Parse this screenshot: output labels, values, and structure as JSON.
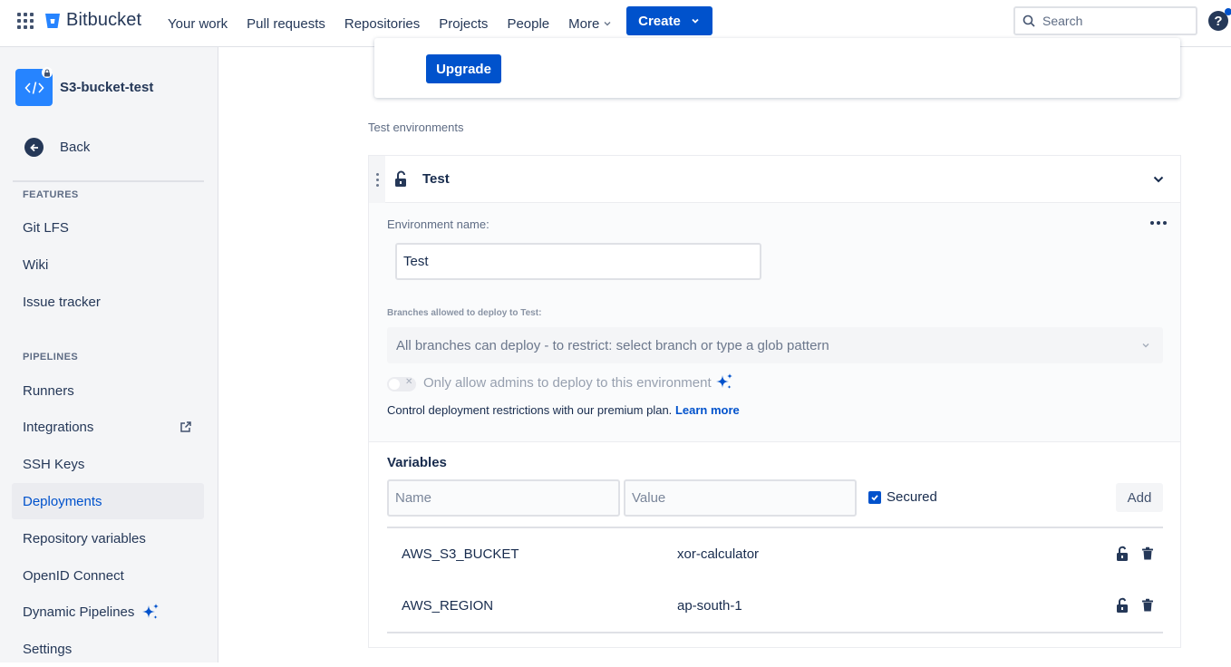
{
  "topbar": {
    "brand": "Bitbucket",
    "nav": [
      "Your work",
      "Pull requests",
      "Repositories",
      "Projects",
      "People",
      "More"
    ],
    "create_label": "Create",
    "search_placeholder": "Search",
    "help_label": "?"
  },
  "sidebar": {
    "repo_name": "S3-bucket-test",
    "back_label": "Back",
    "features_title": "FEATURES",
    "features": [
      "Git LFS",
      "Wiki",
      "Issue tracker"
    ],
    "pipelines_title": "PIPELINES",
    "pipelines": [
      "Runners",
      "Integrations",
      "SSH Keys",
      "Deployments",
      "Repository variables",
      "OpenID Connect",
      "Dynamic Pipelines",
      "Settings"
    ],
    "active_item": "Deployments"
  },
  "main": {
    "upgrade_label": "Upgrade",
    "section_title": "Test environments",
    "environment": {
      "title": "Test",
      "name_label": "Environment name:",
      "name_value": "Test",
      "branches_label": "Branches allowed to deploy to Test:",
      "branches_value": "All branches can deploy - to restrict: select branch or type a glob pattern",
      "admin_toggle_label": "Only allow admins to deploy to this environment",
      "control_text": "Control deployment restrictions with our premium plan.",
      "learn_more": "Learn more"
    },
    "variables": {
      "title": "Variables",
      "name_placeholder": "Name",
      "value_placeholder": "Value",
      "secured_label": "Secured",
      "add_label": "Add",
      "rows": [
        {
          "key": "AWS_S3_BUCKET",
          "value": "xor-calculator"
        },
        {
          "key": "AWS_REGION",
          "value": "ap-south-1"
        }
      ]
    }
  },
  "colors": {
    "primary": "#0052cc",
    "sidebar_bg": "#f4f5f7",
    "text": "#172b4d"
  }
}
